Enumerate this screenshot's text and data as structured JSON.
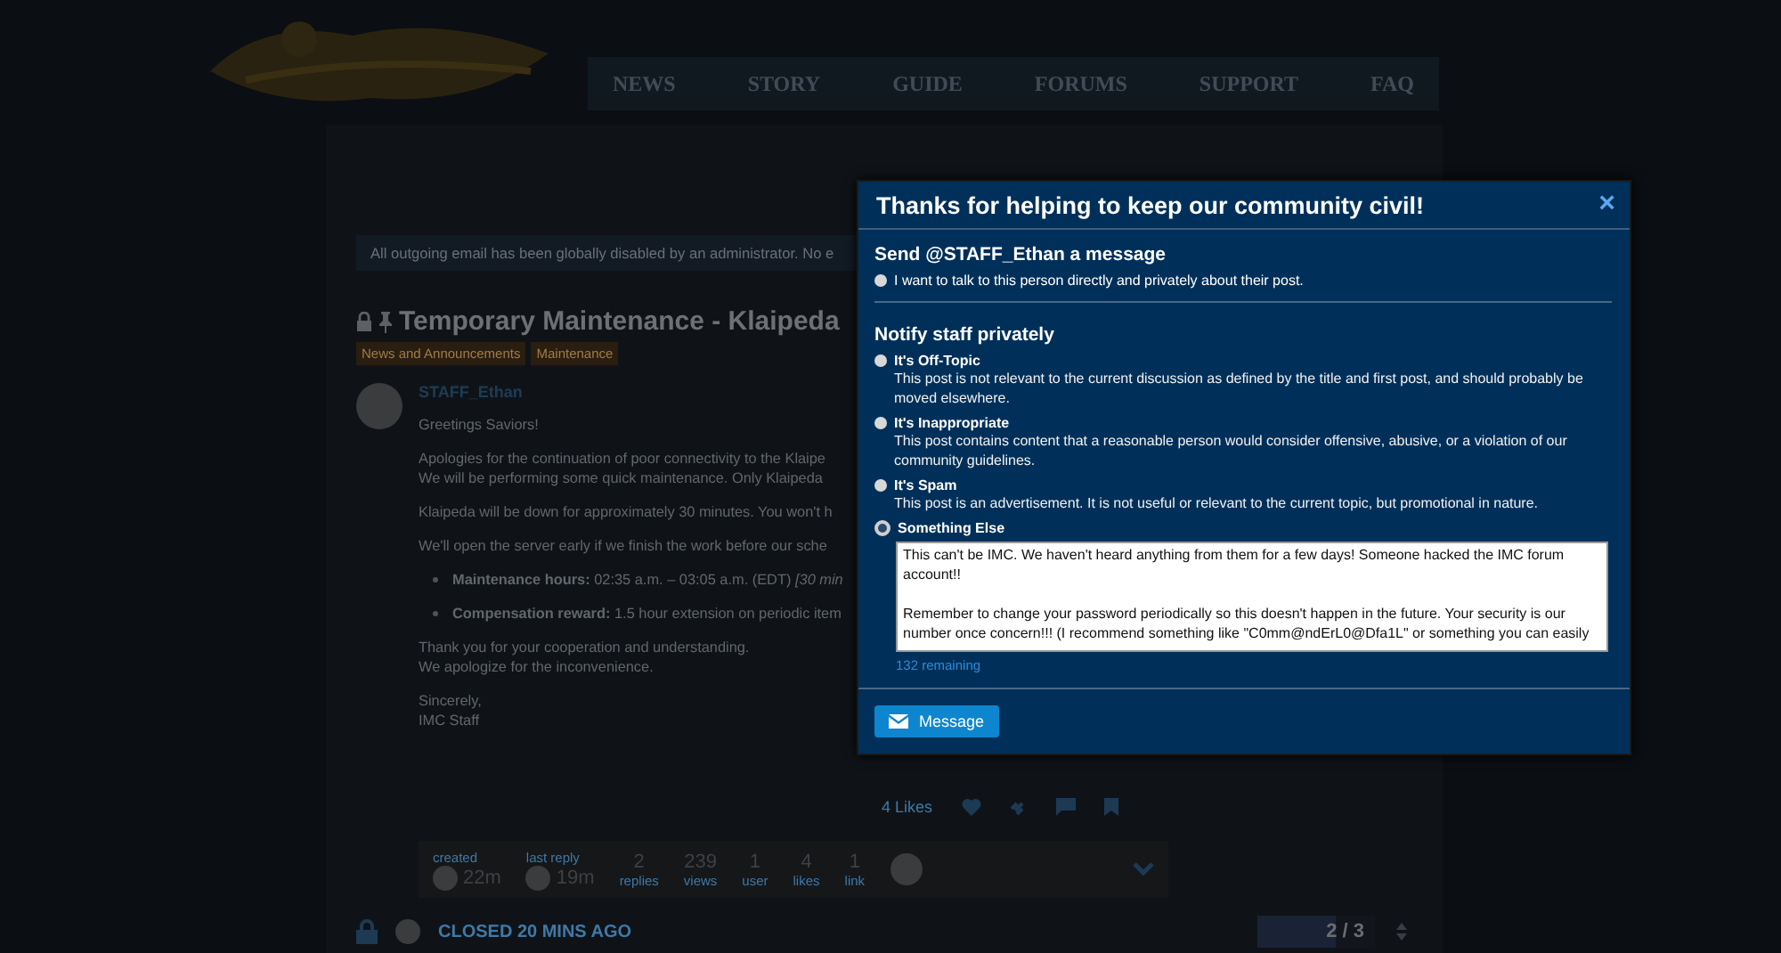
{
  "nav": [
    {
      "label": "NEWS"
    },
    {
      "label": "STORY"
    },
    {
      "label": "GUIDE"
    },
    {
      "label": "FORUMS"
    },
    {
      "label": "SUPPORT"
    },
    {
      "label": "FAQ"
    }
  ],
  "notice": "All outgoing email has been globally disabled by an administrator. No e",
  "topic": {
    "title": "Temporary Maintenance - Klaipeda",
    "tags": [
      "News and Announcements",
      "Maintenance"
    ]
  },
  "post": {
    "author": "STAFF_Ethan",
    "paragraphs": [
      {
        "kind": "p",
        "lines": [
          "Greetings Saviors!"
        ]
      },
      {
        "kind": "p",
        "lines": [
          "Apologies for the continuation of poor connectivity to the Klaipe",
          "We will be performing some quick maintenance. Only Klaipeda"
        ]
      },
      {
        "kind": "p",
        "lines": [
          "Klaipeda will be down for approximately 30 minutes. You won't h"
        ]
      },
      {
        "kind": "p",
        "lines": [
          "We'll open the server early if we finish the work before our sche"
        ]
      },
      {
        "kind": "bullet",
        "lines": [
          "**Maintenance hours:** 02:35 a.m. – 03:05 a.m. (EDT) *[30 min*"
        ]
      },
      {
        "kind": "bullet",
        "lines": [
          "**Compensation reward:** 1.5 hour extension on periodic item"
        ]
      },
      {
        "kind": "p",
        "lines": [
          "Thank you for your cooperation and understanding.",
          "We apologize for the inconvenience."
        ]
      },
      {
        "kind": "p",
        "lines": [
          "Sincerely,",
          "IMC Staff"
        ]
      }
    ],
    "likes": "4 Likes"
  },
  "stats": [
    {
      "kind": "time",
      "label": "created",
      "value": "22m"
    },
    {
      "kind": "time",
      "label": "last reply",
      "value": "19m"
    },
    {
      "kind": "count",
      "label": "replies",
      "value": "2"
    },
    {
      "kind": "count",
      "label": "views",
      "value": "239"
    },
    {
      "kind": "count",
      "label": "user",
      "value": "1"
    },
    {
      "kind": "count",
      "label": "likes",
      "value": "4"
    },
    {
      "kind": "count",
      "label": "link",
      "value": "1"
    }
  ],
  "closed": "CLOSED 20 MINS AGO",
  "progress": {
    "label": "2 / 3",
    "level": 0.67
  },
  "modal": {
    "title": "Thanks for helping to keep our community civil!",
    "sections": [
      {
        "heading": "Send @STAFF_Ethan a message",
        "options": [
          {
            "kind": "inline",
            "label": "I want to talk to this person directly and privately about their post.",
            "selected": false
          }
        ]
      },
      {
        "heading": "Notify staff privately",
        "options": [
          {
            "kind": "titled",
            "label": "It's Off-Topic",
            "description": "This post is not relevant to the current discussion as defined by the title and first post, and should probably be moved elsewhere.",
            "selected": false
          },
          {
            "kind": "titled",
            "label": "It's Inappropriate",
            "description": "This post contains content that a reasonable person would consider offensive, abusive, or a violation of our community guidelines.",
            "selected": false
          },
          {
            "kind": "titled",
            "label": "It's Spam",
            "description": "This post is an advertisement. It is not useful or relevant to the current topic, but promotional in nature.",
            "selected": false
          },
          {
            "kind": "text",
            "label": "Something Else",
            "selected": true,
            "value": "This can't be IMC. We haven't heard anything from them for a few days! Someone hacked the IMC forum account!!\n\nRemember to change your password periodically so this doesn't happen in the future. Your security is our number once concern!!! (I recommend something like \"C0mm@ndErL0@Dfa1L\" or something you can easily",
            "remaining": "132 remaining"
          }
        ]
      }
    ],
    "close": "×",
    "button": "Message"
  }
}
